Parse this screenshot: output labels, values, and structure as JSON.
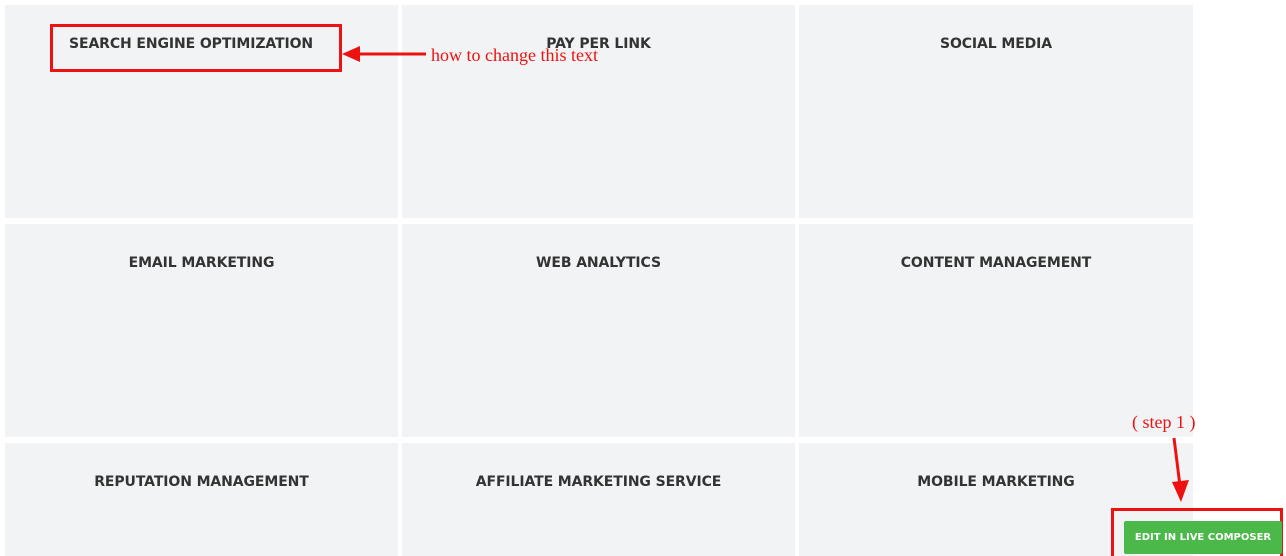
{
  "services": {
    "tiles": [
      {
        "title": "SEARCH ENGINE OPTIMIZATION"
      },
      {
        "title": "PAY PER LINK"
      },
      {
        "title": "SOCIAL MEDIA"
      },
      {
        "title": "EMAIL MARKETING"
      },
      {
        "title": "WEB ANALYTICS"
      },
      {
        "title": "CONTENT MANAGEMENT"
      },
      {
        "title": "REPUTATION MANAGEMENT"
      },
      {
        "title": "AFFILIATE MARKETING SERVICE"
      },
      {
        "title": "MOBILE MARKETING"
      }
    ]
  },
  "annotations": {
    "title_note": "how to change this text",
    "step_note": "( step 1 )",
    "color": "#ee1111"
  },
  "live_composer": {
    "button_label": "EDIT IN LIVE COMPOSER",
    "color": "#4bb84a"
  }
}
